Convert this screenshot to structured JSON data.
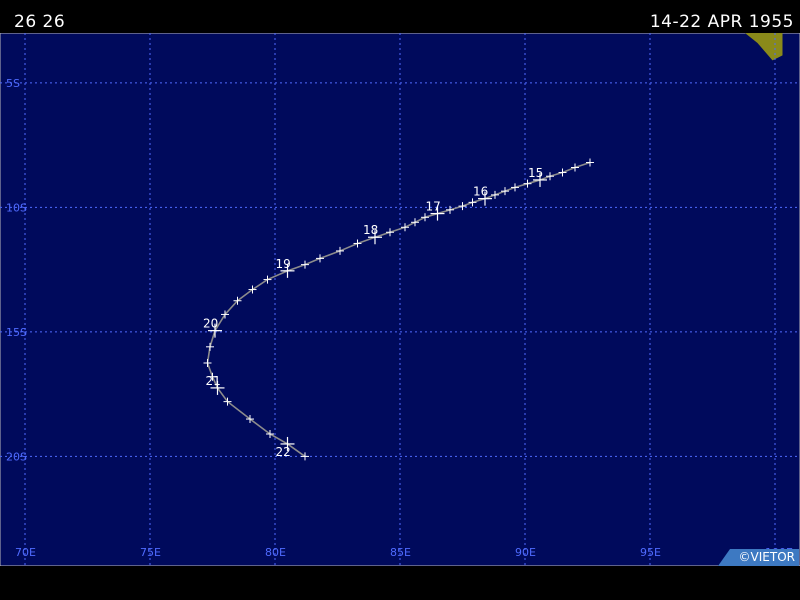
{
  "header": {
    "storm_id": "26 26",
    "date_range": "14-22 APR 1955"
  },
  "map": {
    "lon_range": [
      69,
      101
    ],
    "lat_range": [
      -3,
      -24.4
    ],
    "lon_ticks": [
      "70E",
      "75E",
      "80E",
      "85E",
      "90E",
      "95E",
      "100E"
    ],
    "lat_ticks": [
      "5S",
      "10S",
      "15S",
      "20S"
    ],
    "colors": {
      "ocean": "#000a5c",
      "grid": "#4f6bff",
      "track": "#8c8c8c",
      "marker": "#ffffff",
      "land": "#8a8a1a"
    }
  },
  "track": {
    "points": [
      [
        92.6,
        -8.2
      ],
      [
        92.0,
        -8.4
      ],
      [
        91.5,
        -8.6
      ],
      [
        91.0,
        -8.75
      ],
      [
        90.6,
        -8.9
      ],
      [
        90.1,
        -9.05
      ],
      [
        89.6,
        -9.2
      ],
      [
        89.2,
        -9.35
      ],
      [
        88.8,
        -9.5
      ],
      [
        88.4,
        -9.65
      ],
      [
        87.9,
        -9.8
      ],
      [
        87.5,
        -9.95
      ],
      [
        87.0,
        -10.1
      ],
      [
        86.5,
        -10.25
      ],
      [
        86.0,
        -10.4
      ],
      [
        85.6,
        -10.6
      ],
      [
        85.2,
        -10.8
      ],
      [
        84.6,
        -11.0
      ],
      [
        84.0,
        -11.2
      ],
      [
        83.3,
        -11.45
      ],
      [
        82.6,
        -11.75
      ],
      [
        81.8,
        -12.05
      ],
      [
        81.2,
        -12.3
      ],
      [
        80.5,
        -12.55
      ],
      [
        79.7,
        -12.9
      ],
      [
        79.1,
        -13.3
      ],
      [
        78.5,
        -13.75
      ],
      [
        78.0,
        -14.3
      ],
      [
        77.6,
        -14.95
      ],
      [
        77.4,
        -15.6
      ],
      [
        77.3,
        -16.25
      ],
      [
        77.5,
        -16.8
      ],
      [
        77.7,
        -17.25
      ],
      [
        78.1,
        -17.8
      ],
      [
        79.0,
        -18.5
      ],
      [
        79.8,
        -19.1
      ],
      [
        80.5,
        -19.5
      ],
      [
        81.2,
        -20.0
      ]
    ],
    "day_labels": [
      {
        "label": "15",
        "lon": 90.6,
        "lat": -8.9
      },
      {
        "label": "16",
        "lon": 88.4,
        "lat": -9.65
      },
      {
        "label": "17",
        "lon": 86.5,
        "lat": -10.25
      },
      {
        "label": "18",
        "lon": 84.0,
        "lat": -11.2
      },
      {
        "label": "19",
        "lon": 80.5,
        "lat": -12.55
      },
      {
        "label": "20",
        "lon": 77.6,
        "lat": -14.95
      },
      {
        "label": "21",
        "lon": 77.7,
        "lat": -17.25
      },
      {
        "label": "22",
        "lon": 80.5,
        "lat": -19.5
      }
    ]
  },
  "credit": "©VIETOR"
}
